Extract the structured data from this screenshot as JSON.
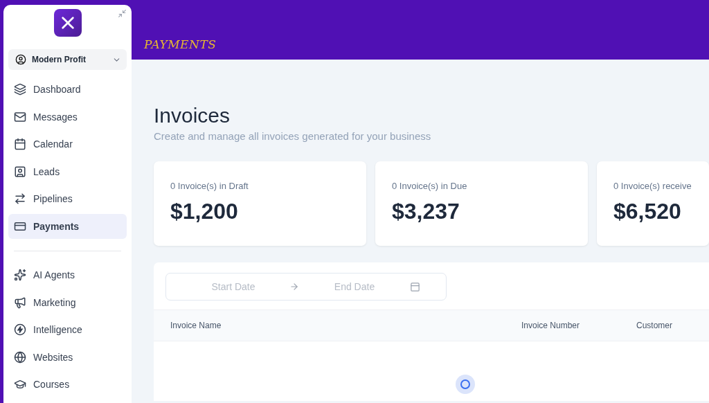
{
  "sidebar": {
    "account": {
      "name": "Modern Profit"
    },
    "groups": [
      {
        "items": [
          {
            "label": "Dashboard",
            "selected": false
          },
          {
            "label": "Messages",
            "selected": false
          },
          {
            "label": "Calendar",
            "selected": false
          },
          {
            "label": "Leads",
            "selected": false
          },
          {
            "label": "Pipelines",
            "selected": false
          },
          {
            "label": "Payments",
            "selected": true
          }
        ]
      },
      {
        "items": [
          {
            "label": "AI Agents",
            "selected": false
          },
          {
            "label": "Marketing",
            "selected": false
          },
          {
            "label": "Intelligence",
            "selected": false
          },
          {
            "label": "Websites",
            "selected": false
          },
          {
            "label": "Courses",
            "selected": false
          }
        ]
      }
    ]
  },
  "header": {
    "title": "PAYMENTS"
  },
  "page": {
    "title": "Invoices",
    "subtitle": "Create and manage all invoices generated for your business"
  },
  "stats": [
    {
      "label": "0 Invoice(s) in Draft",
      "value": "$1,200"
    },
    {
      "label": "0 Invoice(s) in Due",
      "value": "$3,237"
    },
    {
      "label": "0 Invoice(s) receive",
      "value": "$6,520"
    }
  ],
  "table": {
    "date_range": {
      "start_placeholder": "Start Date",
      "end_placeholder": "End Date"
    },
    "columns": [
      "Invoice Name",
      "Invoice Number",
      "Customer"
    ],
    "loading": true
  }
}
